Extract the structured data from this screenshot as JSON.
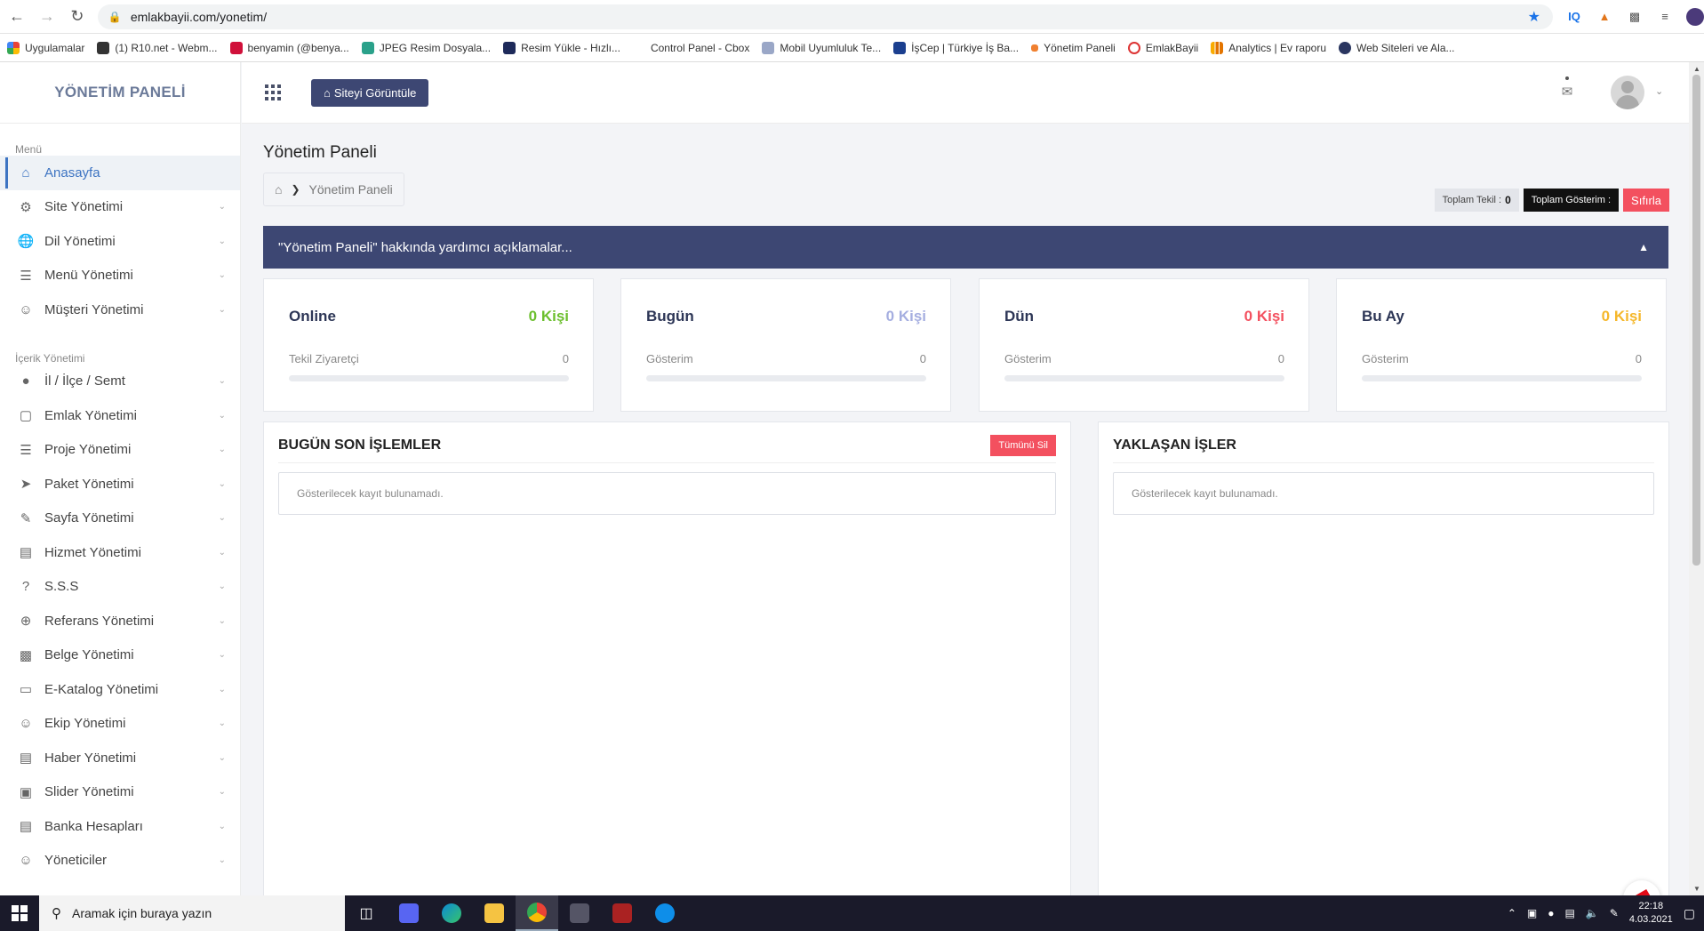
{
  "browser": {
    "url": "emlakbayii.com/yonetim/",
    "bookmarks": [
      "Uygulamalar",
      "(1) R10.net - Webm...",
      "benyamin (@benya...",
      "JPEG Resim Dosyala...",
      "Resim Yükle - Hızlı...",
      "Control Panel - Cbox",
      "Mobil Uyumluluk Te...",
      "İşCep | Türkiye İş Ba...",
      "Yönetim Paneli",
      "EmlakBayii",
      "Analytics | Ev raporu",
      "Web Siteleri ve Ala..."
    ],
    "ext_iq": "IQ"
  },
  "sidebar": {
    "logo": "YÖNETİM PANELİ",
    "menu_head": "Menü",
    "menu_items": [
      "Anasayfa",
      "Site Yönetimi",
      "Dil Yönetimi",
      "Menü Yönetimi",
      "Müşteri Yönetimi"
    ],
    "content_head": "İçerik Yönetimi",
    "content_items": [
      "İl / İlçe / Semt",
      "Emlak Yönetimi",
      "Proje Yönetimi",
      "Paket Yönetimi",
      "Sayfa Yönetimi",
      "Hizmet Yönetimi",
      "S.S.S",
      "Referans Yönetimi",
      "Belge Yönetimi",
      "E-Katalog Yönetimi",
      "Ekip Yönetimi",
      "Haber Yönetimi",
      "Slider Yönetimi",
      "Banka Hesapları",
      "Yöneticiler"
    ]
  },
  "topbar": {
    "site_button": "Siteyi Görüntüle"
  },
  "page": {
    "title": "Yönetim Paneli",
    "breadcrumb": "Yönetim Paneli",
    "total_unique_label": "Toplam Tekil :",
    "total_unique_value": "0",
    "total_views_label": "Toplam Gösterim :",
    "reset_button": "Sıfırla",
    "help_text": "\"Yönetim Paneli\" hakkında yardımcı açıklamalar..."
  },
  "stats": [
    {
      "label": "Online",
      "value": "0 Kişi",
      "sub": "Tekil Ziyaretçi",
      "num": "0",
      "color": "#6cbf2e"
    },
    {
      "label": "Bugün",
      "value": "0 Kişi",
      "sub": "Gösterim",
      "num": "0",
      "color": "#a5aee0"
    },
    {
      "label": "Dün",
      "value": "0 Kişi",
      "sub": "Gösterim",
      "num": "0",
      "color": "#f3505f"
    },
    {
      "label": "Bu Ay",
      "value": "0 Kişi",
      "sub": "Gösterim",
      "num": "0",
      "color": "#f5b72a"
    }
  ],
  "panels": {
    "recent_title": "BUGÜN SON İŞLEMLER",
    "delete_all": "Tümünü Sil",
    "recent_empty": "Gösterilecek kayıt bulunamadı.",
    "upcoming_title": "YAKLAŞAN İŞLER",
    "upcoming_empty": "Gösterilecek kayıt bulunamadı."
  },
  "taskbar": {
    "search_placeholder": "Aramak için buraya yazın",
    "time": "22:18",
    "date": "4.03.2021"
  }
}
